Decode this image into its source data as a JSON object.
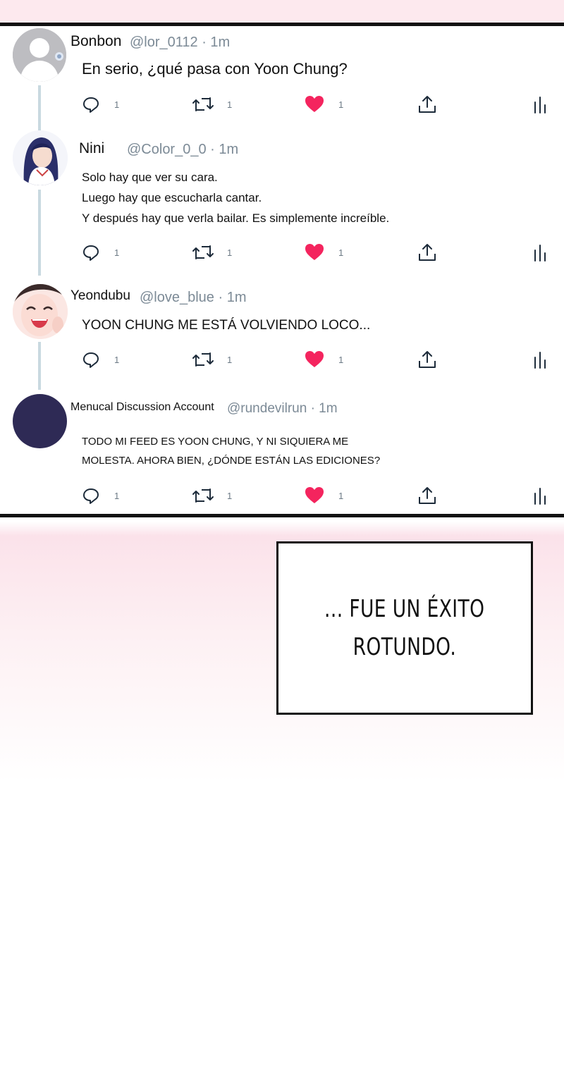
{
  "tweets": [
    {
      "name": "Bonbon",
      "handle": "@lor_0112 · 1m",
      "text": [
        "En serio, ¿qué pasa con Yoon Chung?"
      ],
      "replies": "1",
      "retweets": "1",
      "likes": "1"
    },
    {
      "name": "Nini",
      "handle": "@Color_0_0 · 1m",
      "text": [
        "Solo hay que ver su cara.",
        "Luego hay que escucharla cantar.",
        "Y después hay que verla bailar. Es simplemente increíble."
      ],
      "replies": "1",
      "retweets": "1",
      "likes": "1"
    },
    {
      "name": "Yeondubu",
      "handle": "@love_blue · 1m",
      "text": [
        "YOON CHUNG ME ESTÁ VOLVIENDO LOCO..."
      ],
      "replies": "1",
      "retweets": "1",
      "likes": "1"
    },
    {
      "name": "Menucal Discussion Account",
      "handle": "@rundevilrun · 1m",
      "text": [
        "TODO MI FEED ES YOON CHUNG, Y NI SIQUIERA ME",
        "MOLESTA. AHORA BIEN, ¿DÓNDE ESTÁN LAS EDICIONES?"
      ],
      "replies": "1",
      "retweets": "1",
      "likes": "1"
    }
  ],
  "caption": {
    "lines": [
      "... FUE UN ÉXITO",
      "ROTUNDO."
    ]
  },
  "colors": {
    "like": "#f4245e",
    "icon": "#1d2b3a",
    "thread": "#c9d9e0",
    "avatar_dark": "#2e2a55"
  },
  "icons": {
    "reply": "reply-icon",
    "retweet": "retweet-icon",
    "like": "heart-icon",
    "share": "share-icon",
    "stats": "stats-icon"
  }
}
